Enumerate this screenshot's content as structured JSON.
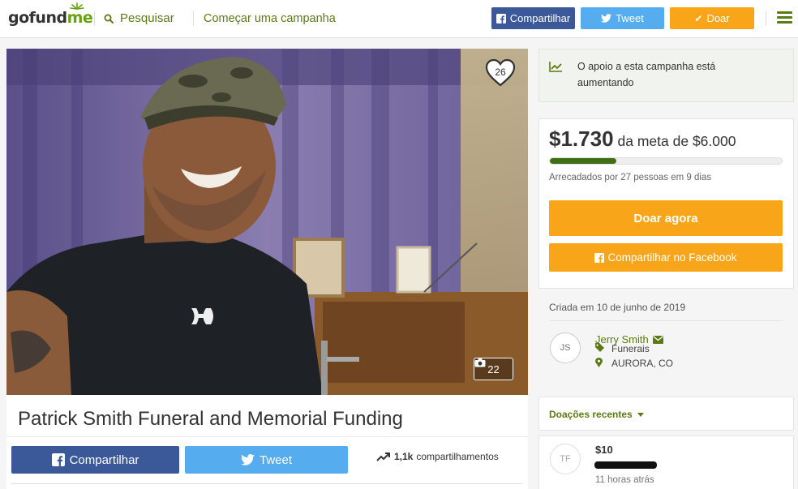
{
  "header": {
    "logo_prefix": "gofund",
    "logo_suffix": "me",
    "search_label": "Pesquisar",
    "start_campaign_label": "Começar uma campanha",
    "share_label": "Compartilhar",
    "tweet_label": "Tweet",
    "donate_label": "Doar"
  },
  "media": {
    "heart_count": "26",
    "photo_count": "22"
  },
  "campaign": {
    "title": "Patrick Smith Funeral and Memorial Funding",
    "share_label": "Compartilhar",
    "tweet_label": "Tweet",
    "shares_count": "1,1k",
    "shares_label": "compartilhamentos"
  },
  "trend": {
    "text": "O apoio a esta campanha está aumentando"
  },
  "progress": {
    "raised": "$1.730",
    "goal_text": "da meta de $6.000",
    "fraction": 0.288,
    "raised_by": "Arrecadados por 27 pessoas em 9 dias",
    "donate_now_label": "Doar agora",
    "share_facebook_label": "Compartilhar no Facebook"
  },
  "organizer": {
    "created": "Criada em 10 de junho de 2019",
    "initials": "JS",
    "name": "Jerry Smith",
    "category": "Funerais",
    "location": "AURORA, CO"
  },
  "recent_donations": {
    "label": "Doações recentes",
    "items": [
      {
        "initials": "TF",
        "amount": "$10",
        "time": "11 horas atrás"
      }
    ]
  },
  "colors": {
    "brand_green": "#5c7a14",
    "facebook": "#3b5998",
    "twitter": "#55acee",
    "donate_orange": "#f9a51a",
    "progress_fill": "#3f6e16"
  }
}
